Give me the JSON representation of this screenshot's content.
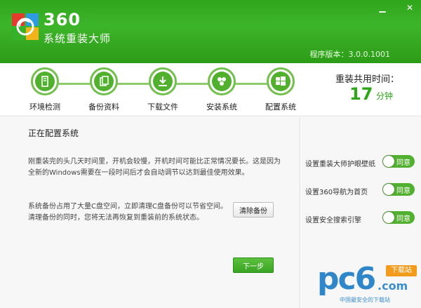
{
  "header": {
    "brand_number": "360",
    "brand_name": "系统重装大师",
    "version": "程序版本：3.0.0.1001",
    "minimize_glyph": "▁",
    "close_glyph": "✕"
  },
  "steps": [
    {
      "label": "环境检测",
      "icon": "monitor-icon"
    },
    {
      "label": "备份资料",
      "icon": "backup-icon"
    },
    {
      "label": "下载文件",
      "icon": "download-icon"
    },
    {
      "label": "安装系统",
      "icon": "install-icon"
    },
    {
      "label": "配置系统",
      "icon": "windows-config-icon"
    }
  ],
  "timer": {
    "title": "重装共用时间：",
    "value": "17",
    "unit": "分钟"
  },
  "main": {
    "status_title": "正在配置系统",
    "para1_line1": "刚重装完的头几天时间里，开机会较慢，开机时间可能比正常情况要长。这是因为",
    "para1_line2": "全新的Windows需要在一段时间后才会自动调节以达到最佳使用效果。",
    "para2_line1": "系统备份占用了大量C盘空间，立即清理C盘备份可以节省空间。",
    "para2_line2": "清理备份的同时，您将无法再恢复到重装前的系统状态。",
    "clear_button": "清除备份",
    "next_button": "下一步"
  },
  "options": [
    {
      "label": "设置重装大师护眼壁纸",
      "toggle": "同意"
    },
    {
      "label": "设置360导航为首页",
      "toggle": "同意"
    },
    {
      "label": "设置安全搜索引擎",
      "toggle": "同意"
    }
  ],
  "watermark": {
    "brand": "pc6",
    "tag": "下载站",
    "domain": ".com",
    "slogan": "中国最安全的下载站"
  },
  "colors": {
    "accent": "#2fa51a",
    "watermark_blue": "#2f86c9",
    "watermark_orange": "#f39b1d"
  }
}
